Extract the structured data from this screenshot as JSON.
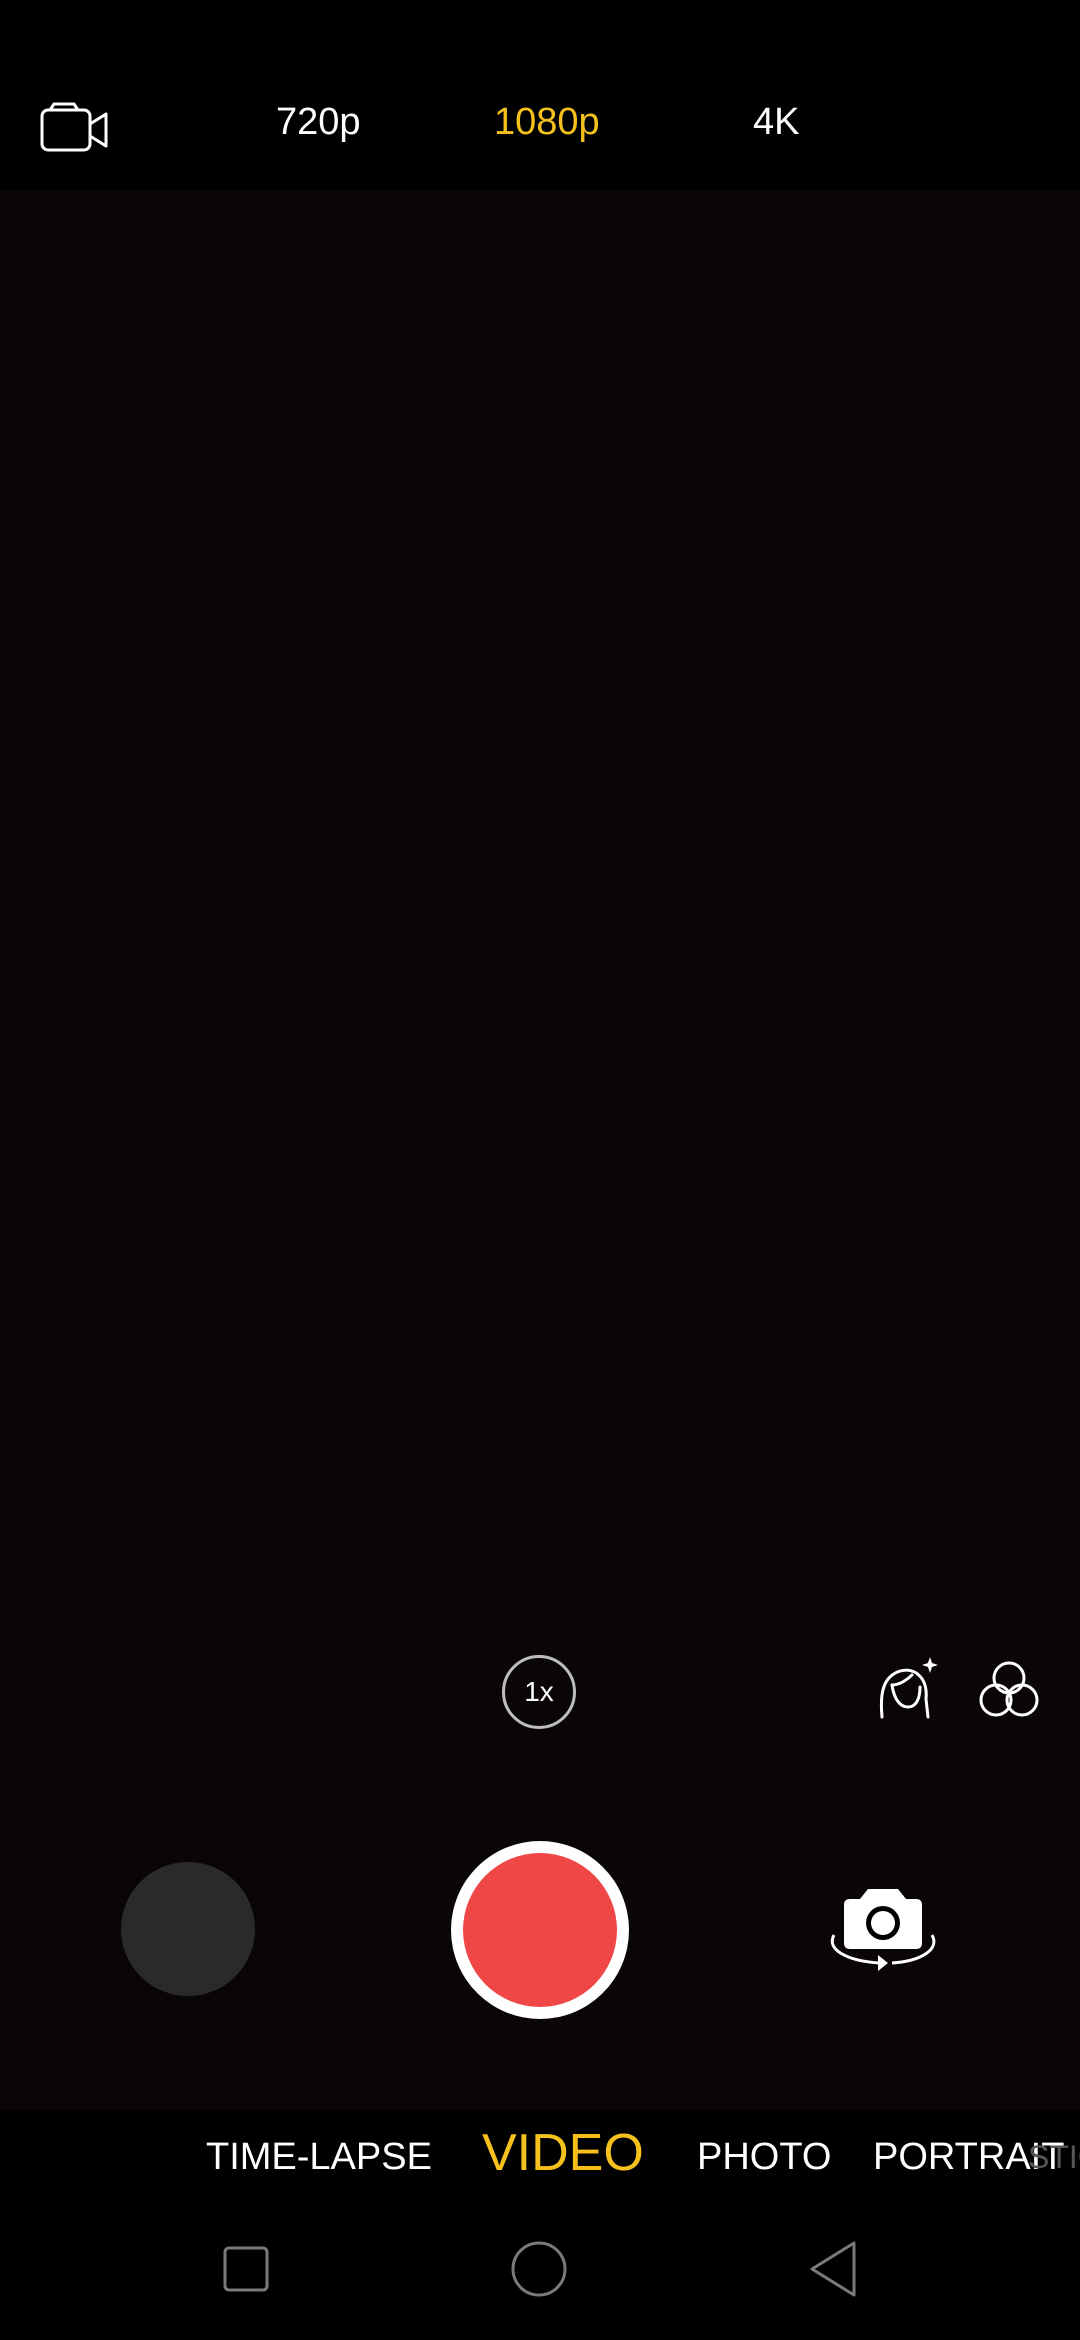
{
  "top_bar": {
    "mode_icon": "video-camera-icon",
    "resolutions": [
      {
        "label": "720p",
        "selected": false
      },
      {
        "label": "1080p",
        "selected": true
      },
      {
        "label": "4K",
        "selected": false
      }
    ]
  },
  "controls": {
    "zoom_label": "1x",
    "beauty_icon": "face-beauty-icon",
    "filter_icon": "filter-icon",
    "shutter_icon": "record-button",
    "flip_icon": "camera-switch-icon"
  },
  "modes": [
    {
      "label": "TIME-LAPSE",
      "selected": false
    },
    {
      "label": "VIDEO",
      "selected": true
    },
    {
      "label": "PHOTO",
      "selected": false
    },
    {
      "label": "PORTRAIT",
      "selected": false
    },
    {
      "label": "STIC",
      "selected": false
    }
  ],
  "navigation": {
    "recents_icon": "square-icon",
    "home_icon": "circle-icon",
    "back_icon": "triangle-back-icon"
  },
  "colors": {
    "accent": "#f6c11c",
    "record": "#ef4646",
    "background": "#000000"
  }
}
